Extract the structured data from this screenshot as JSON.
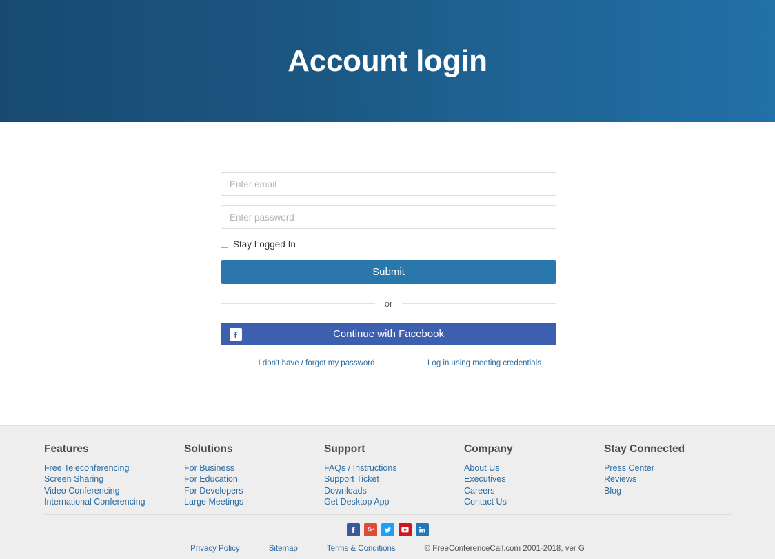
{
  "hero": {
    "title": "Account login",
    "gradient_from": "#184a71",
    "gradient_to": "#2270a8"
  },
  "login": {
    "email_placeholder": "Enter email",
    "email_value": "",
    "password_placeholder": "Enter password",
    "password_value": "",
    "stay_logged_in_label": "Stay Logged In",
    "stay_logged_in_checked": false,
    "submit_label": "Submit",
    "submit_color": "#2a78ab",
    "or_label": "or",
    "facebook_label": "Continue with Facebook",
    "facebook_color": "#3d5fb0",
    "facebook_icon": "facebook-icon",
    "forgot_password_label": "I don't have / forgot my password",
    "meeting_credentials_label": "Log in using meeting credentials",
    "link_color": "#2b6ca3"
  },
  "footer": {
    "columns": [
      {
        "heading": "Features",
        "links": [
          "Free Teleconferencing",
          "Screen Sharing",
          "Video Conferencing",
          "International Conferencing"
        ]
      },
      {
        "heading": "Solutions",
        "links": [
          "For Business",
          "For Education",
          "For Developers",
          "Large Meetings"
        ]
      },
      {
        "heading": "Support",
        "links": [
          "FAQs / Instructions",
          "Support Ticket",
          "Downloads",
          "Get Desktop App"
        ]
      },
      {
        "heading": "Company",
        "links": [
          "About Us",
          "Executives",
          "Careers",
          "Contact Us"
        ]
      },
      {
        "heading": "Stay Connected",
        "links": [
          "Press Center",
          "Reviews",
          "Blog"
        ]
      }
    ],
    "social": [
      {
        "name": "facebook-icon",
        "color": "#3b5998"
      },
      {
        "name": "googleplus-icon",
        "color": "#dd4b39"
      },
      {
        "name": "twitter-icon",
        "color": "#1da1f2"
      },
      {
        "name": "youtube-icon",
        "color": "#cc181e"
      },
      {
        "name": "linkedin-icon",
        "color": "#2078b5"
      }
    ],
    "bottom_links": [
      "Privacy Policy",
      "Sitemap",
      "Terms & Conditions"
    ],
    "copyright": "© FreeConferenceCall.com 2001-2018, ver G",
    "background": "#eeeeee"
  }
}
